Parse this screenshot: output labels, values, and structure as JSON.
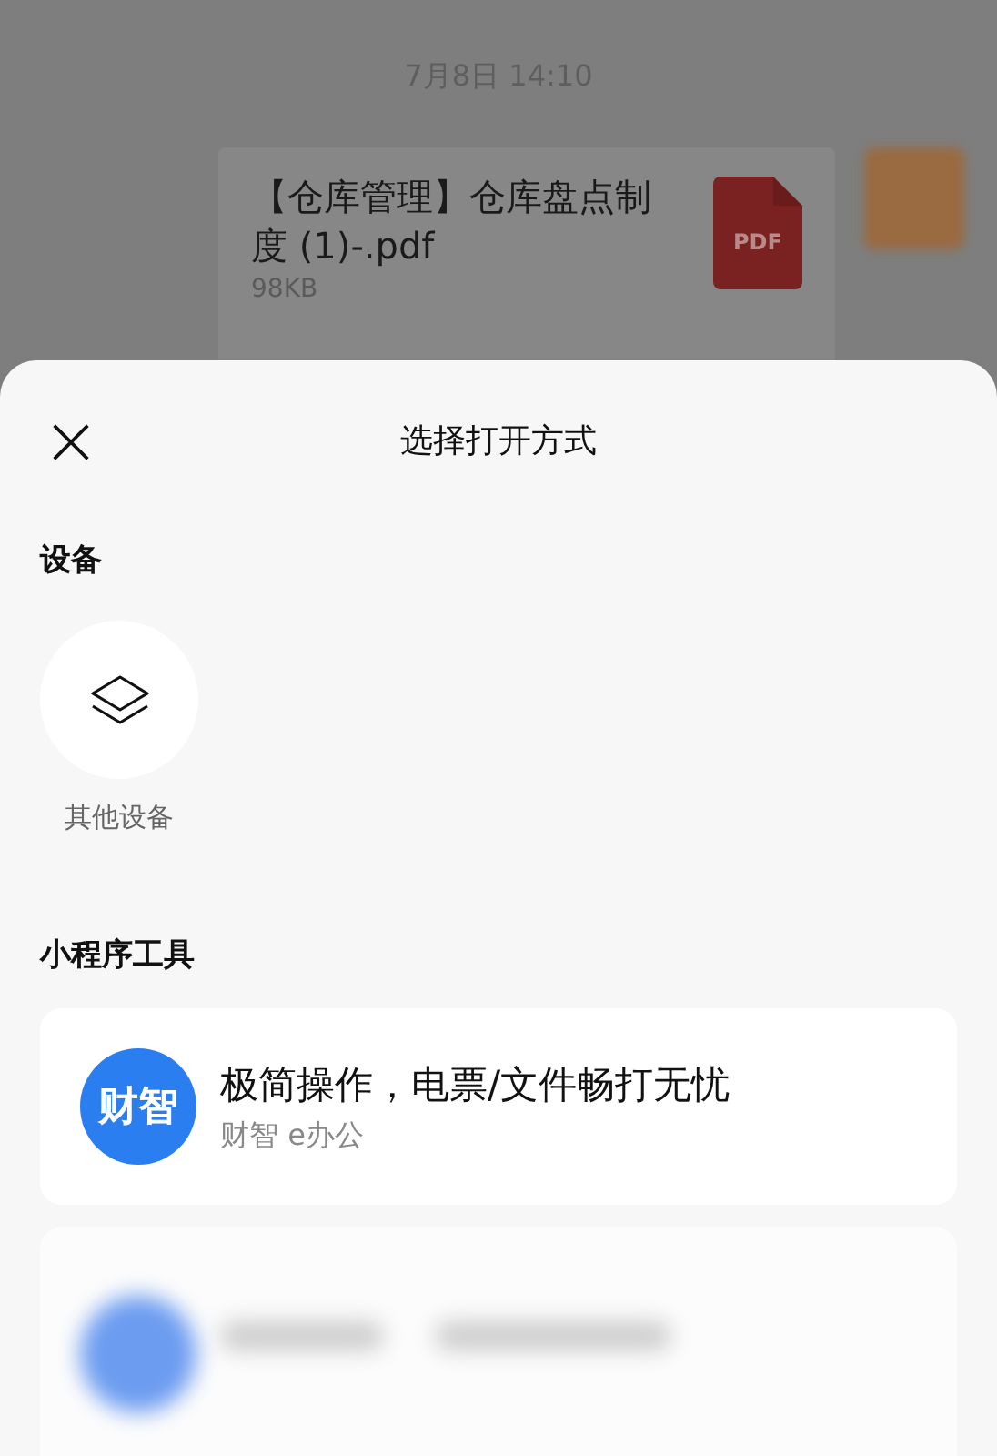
{
  "chat": {
    "timestamp": "7月8日 14:10",
    "file_message": {
      "file_name": "【仓库管理】仓库盘点制度 (1)-.pdf",
      "file_size": "98KB",
      "file_type_label": "PDF"
    }
  },
  "sheet": {
    "title": "选择打开方式",
    "sections": [
      {
        "kind": "devices",
        "heading": "设备",
        "items": [
          {
            "label": "其他设备"
          }
        ]
      },
      {
        "kind": "tools",
        "heading": "小程序工具",
        "items": [
          {
            "kind": "app",
            "logo_text": "财智",
            "title": "极简操作，电票/文件畅打无忧",
            "subtitle": "财智 e办公"
          },
          {
            "kind": "blurred"
          }
        ]
      }
    ]
  }
}
